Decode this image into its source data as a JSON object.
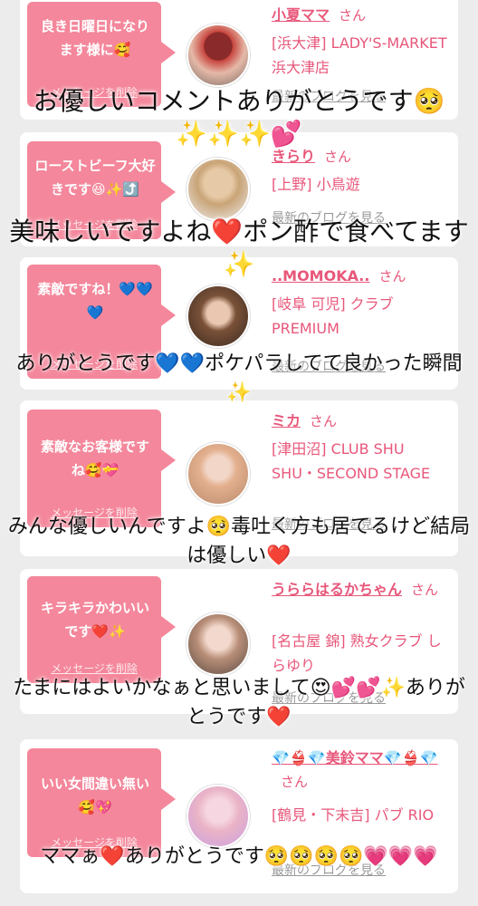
{
  "colors": {
    "accent": "#f4879b",
    "link": "#e8577a",
    "background": "#ececec"
  },
  "cards": [
    {
      "bubble_text": "良き日曜日になります様に🥰",
      "delete_label": "メッセージを削除",
      "name": "小夏ママ",
      "san": "さん",
      "shop": "[浜大津] LADY'S-MARKET 浜大津店",
      "blog_link": "最新のブログを見る"
    },
    {
      "bubble_text": "ローストビーフ大好きです😆✨⤴️",
      "delete_label": "メッセージを削除",
      "name": "きらり",
      "san": "さん",
      "shop": "[上野] 小鳥遊",
      "blog_link": "最新のブログを見る"
    },
    {
      "bubble_text": "素敵ですね！💙💙💙",
      "delete_label": "メッセージを削除",
      "name": "..MOMOKA..",
      "san": "さん",
      "shop": "[岐阜 可児] クラブ PREMIUM",
      "blog_link": "最新のブログを見る"
    },
    {
      "bubble_text": "素敵なお客様ですね🥰💝",
      "delete_label": "メッセージを削除",
      "name": "ミカ",
      "san": "さん",
      "shop": "[津田沼] CLUB SHU SHU・SECOND STAGE",
      "blog_link": "最新のブログを見る"
    },
    {
      "bubble_text": "キラキラかわいいです❤️✨",
      "delete_label": "メッセージを削除",
      "name": "うららはるかちゃん",
      "san": "さん",
      "shop": "[名古屋 錦] 熟女クラブ しらゆり",
      "blog_link": "最新のブログを見る"
    },
    {
      "bubble_text": "いい女間違い無い🥰💖",
      "delete_label": "メッセージを削除",
      "name": "💎👙💎美鈴ママ💎👙💎",
      "san": "さん",
      "shop": "[鶴見・下末吉] パブ RIO",
      "blog_link": "最新のブログを見る"
    }
  ],
  "replies": [
    "お優しいコメントありがとうです🥺✨✨✨💕",
    "美味しいですよね❤️ポン酢で食べてます✨",
    "ありがとうです💙💙ポケパラしてて良かった瞬間✨",
    "みんな優しいんですよ🥺毒吐く方も居てるけど結局は優しい❤️",
    "たまにはよいかなぁと思いまして😍💕💕✨ありがとうです❤️",
    "ママぁ❤️ありがとうです🥺🥺🥺🥺💗💗💗"
  ]
}
